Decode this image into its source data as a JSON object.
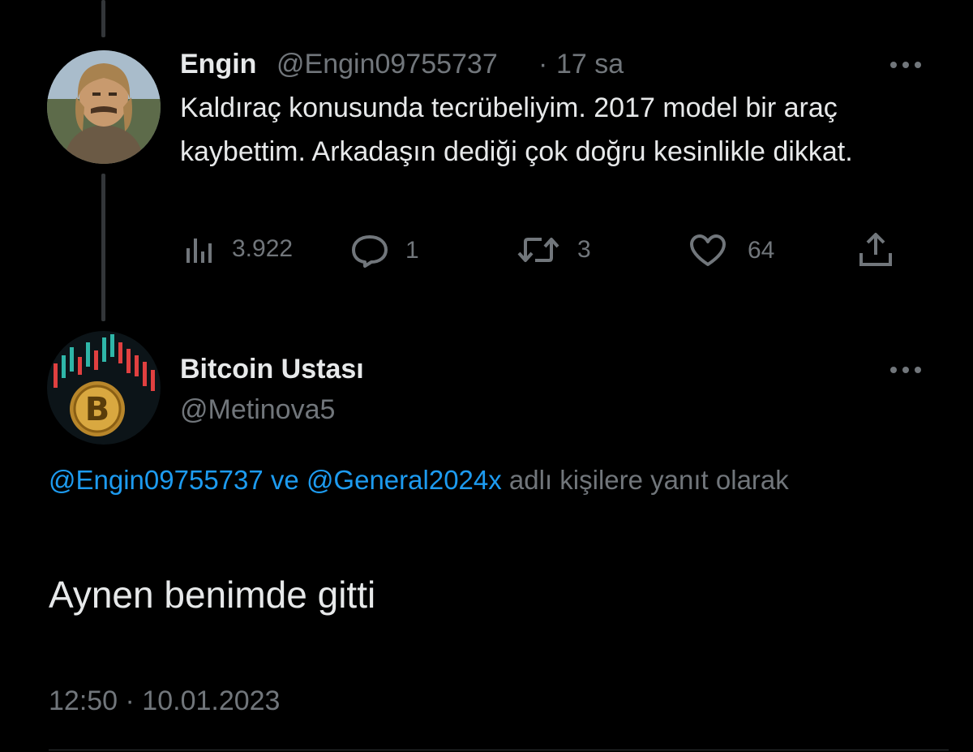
{
  "parent_tweet": {
    "display_name": "Engin",
    "handle": "@Engin09755737",
    "separator": "·",
    "time_ago": "17 sa",
    "more_icon": "more-horizontal-icon",
    "text": "Kaldıraç konusunda tecrübeliyim. 2017 model bir araç kaybettim. Arkadaşın dediği çok doğru kesinlikle dikkat.",
    "metrics": {
      "views": "3.922",
      "replies": "1",
      "retweets": "3",
      "likes": "64"
    }
  },
  "main_tweet": {
    "display_name": "Bitcoin Ustası",
    "handle": "@Metinova5",
    "more_icon": "more-horizontal-icon",
    "reply_to": {
      "mention_1": "@Engin09755737",
      "connector": " ve ",
      "mention_2": "@General2024x",
      "suffix": " adlı kişilere yanıt olarak"
    },
    "text": "Aynen benimde gitti",
    "timestamp": "12:50 · 10.01.2023"
  },
  "colors": {
    "background": "#000000",
    "text_primary": "#e7e9ea",
    "text_secondary": "#71767b",
    "accent": "#1d9bf0",
    "divider": "#2f3336"
  }
}
